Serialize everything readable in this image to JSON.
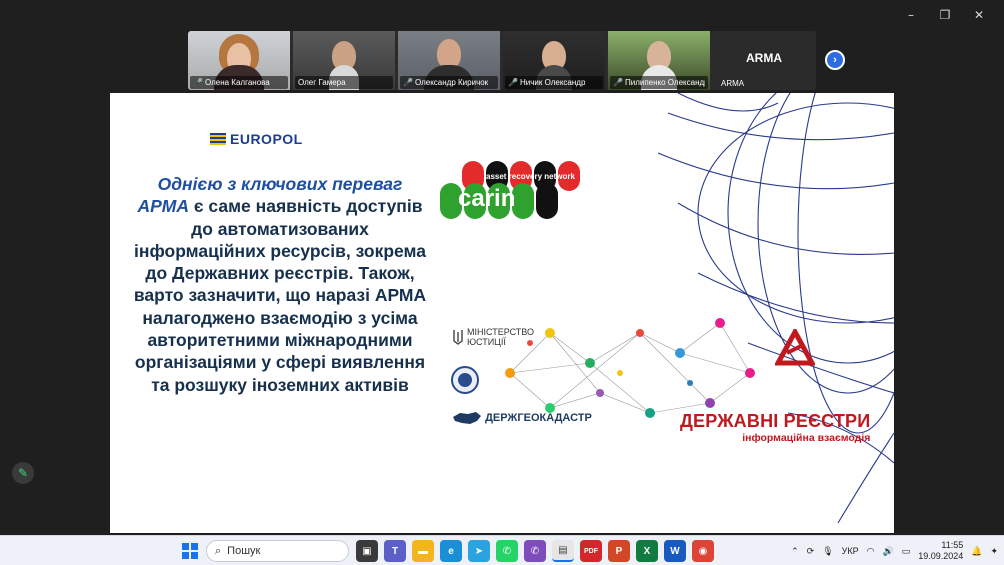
{
  "window": {
    "controls": [
      {
        "name": "minimize",
        "glyph": "–"
      },
      {
        "name": "restore",
        "glyph": "❐"
      },
      {
        "name": "close",
        "glyph": "✕"
      }
    ]
  },
  "participants": [
    {
      "name": "Олена Калганова",
      "muted": true,
      "active": false
    },
    {
      "name": "Олег Гамера",
      "muted": false,
      "active": true
    },
    {
      "name": "Олександр Киричок",
      "muted": true,
      "active": false
    },
    {
      "name": "Ничик Олександр",
      "muted": true,
      "active": false
    },
    {
      "name": "Пилипенко Олександр",
      "muted": true,
      "active": false
    }
  ],
  "text_tile": {
    "big": "ARMA",
    "small": "ARMA"
  },
  "next_icon": "›",
  "slide": {
    "europol": "EUROPOL",
    "text_lead": "Однією з ключових переваг АРМА",
    "text_rest": " є саме наявність доступів до автоматизованих інформаційних ресурсів, зокрема до Державних реєстрів. Також, варто зазначити, що наразі АРМА налагоджено взаємодію з усіма авторитетними міжнародними організаціями у сфері виявлення та розшуку іноземних активів",
    "carin_word": "carin",
    "carin_tag": "asset recovery network",
    "minjust_line1": "МІНІСТЕРСТВО",
    "minjust_line2": "ЮСТИЦІЇ",
    "geo": "ДЕРЖГЕОКАДАСТР",
    "registries_title": "ДЕРЖАВНІ РЕЄСТРИ",
    "registries_sub": "інформаційна взаємодія"
  },
  "taskbar": {
    "search_placeholder": "Пошук",
    "apps": [
      {
        "name": "taskview",
        "color": "#3a3a3a",
        "glyph": "▣"
      },
      {
        "name": "teams",
        "color": "#5b5fc7",
        "glyph": "T"
      },
      {
        "name": "explorer",
        "color": "#f3b51b",
        "glyph": "▬"
      },
      {
        "name": "edge",
        "color": "#1a8fd6",
        "glyph": "e"
      },
      {
        "name": "telegram",
        "color": "#2aa3df",
        "glyph": "➤"
      },
      {
        "name": "whatsapp",
        "color": "#25d366",
        "glyph": "✆"
      },
      {
        "name": "viber",
        "color": "#7d4dbb",
        "glyph": "✆"
      },
      {
        "name": "notepad",
        "color": "#e6e6e6",
        "glyph": "▤"
      },
      {
        "name": "pdf",
        "color": "#d3272b",
        "glyph": "PDF"
      },
      {
        "name": "powerpoint",
        "color": "#d24726",
        "glyph": "P"
      },
      {
        "name": "excel",
        "color": "#107c41",
        "glyph": "X"
      },
      {
        "name": "word",
        "color": "#185abd",
        "glyph": "W"
      },
      {
        "name": "chrome",
        "color": "#db4437",
        "glyph": "◉"
      }
    ],
    "lang": "УКР",
    "time": "11:55",
    "date": "19.09.2024"
  }
}
